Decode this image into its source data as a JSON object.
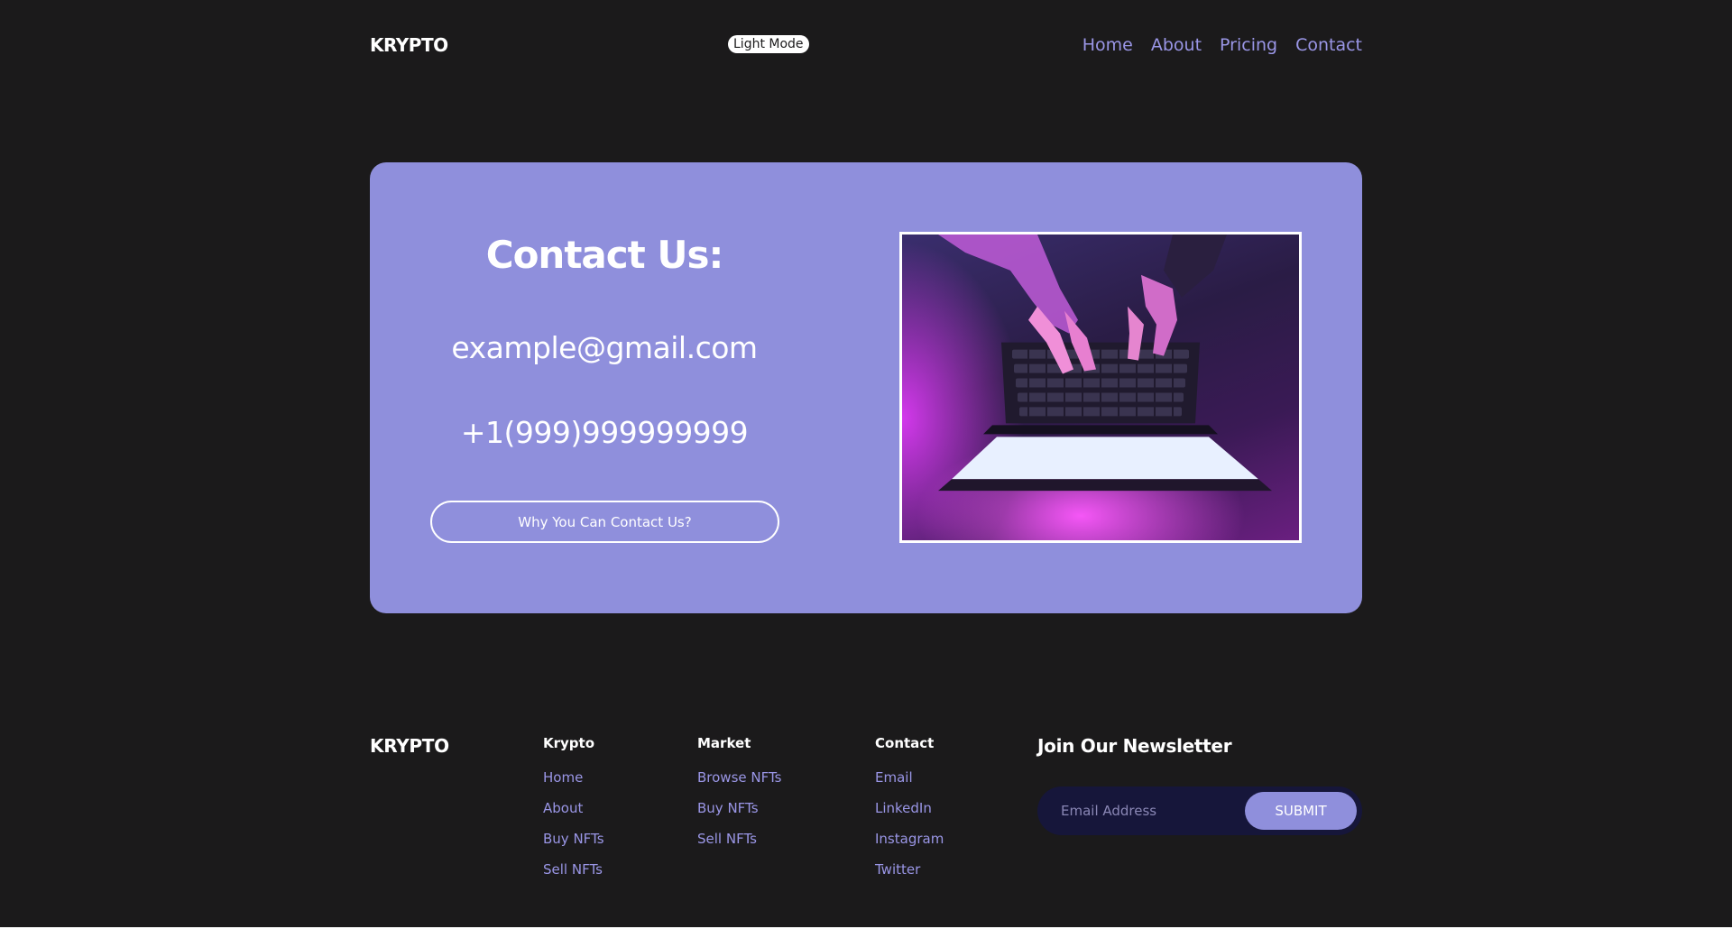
{
  "header": {
    "logo": "KRYPTO",
    "mode_toggle": "Light Mode",
    "nav": [
      "Home",
      "About",
      "Pricing",
      "Contact"
    ]
  },
  "contact": {
    "title": "Contact Us:",
    "email": "example@gmail.com",
    "phone": "+1(999)999999999",
    "button": "Why You Can Contact Us?",
    "image_alt": "hands-typing-on-laptop-purple-light"
  },
  "footer": {
    "logo": "KRYPTO",
    "columns": [
      {
        "heading": "Krypto",
        "links": [
          "Home",
          "About",
          "Buy NFTs",
          "Sell NFTs"
        ]
      },
      {
        "heading": "Market",
        "links": [
          "Browse NFTs",
          "Buy NFTs",
          "Sell NFTs"
        ]
      },
      {
        "heading": "Contact",
        "links": [
          "Email",
          "LinkedIn",
          "Instagram",
          "Twitter"
        ]
      }
    ],
    "newsletter": {
      "title": "Join Our Newsletter",
      "placeholder": "Email Address",
      "submit": "SUBMIT"
    }
  },
  "colors": {
    "background": "#1b1a1b",
    "accent": "#8f8fdc",
    "link": "#9a96e6",
    "input_bg": "#16163a"
  }
}
